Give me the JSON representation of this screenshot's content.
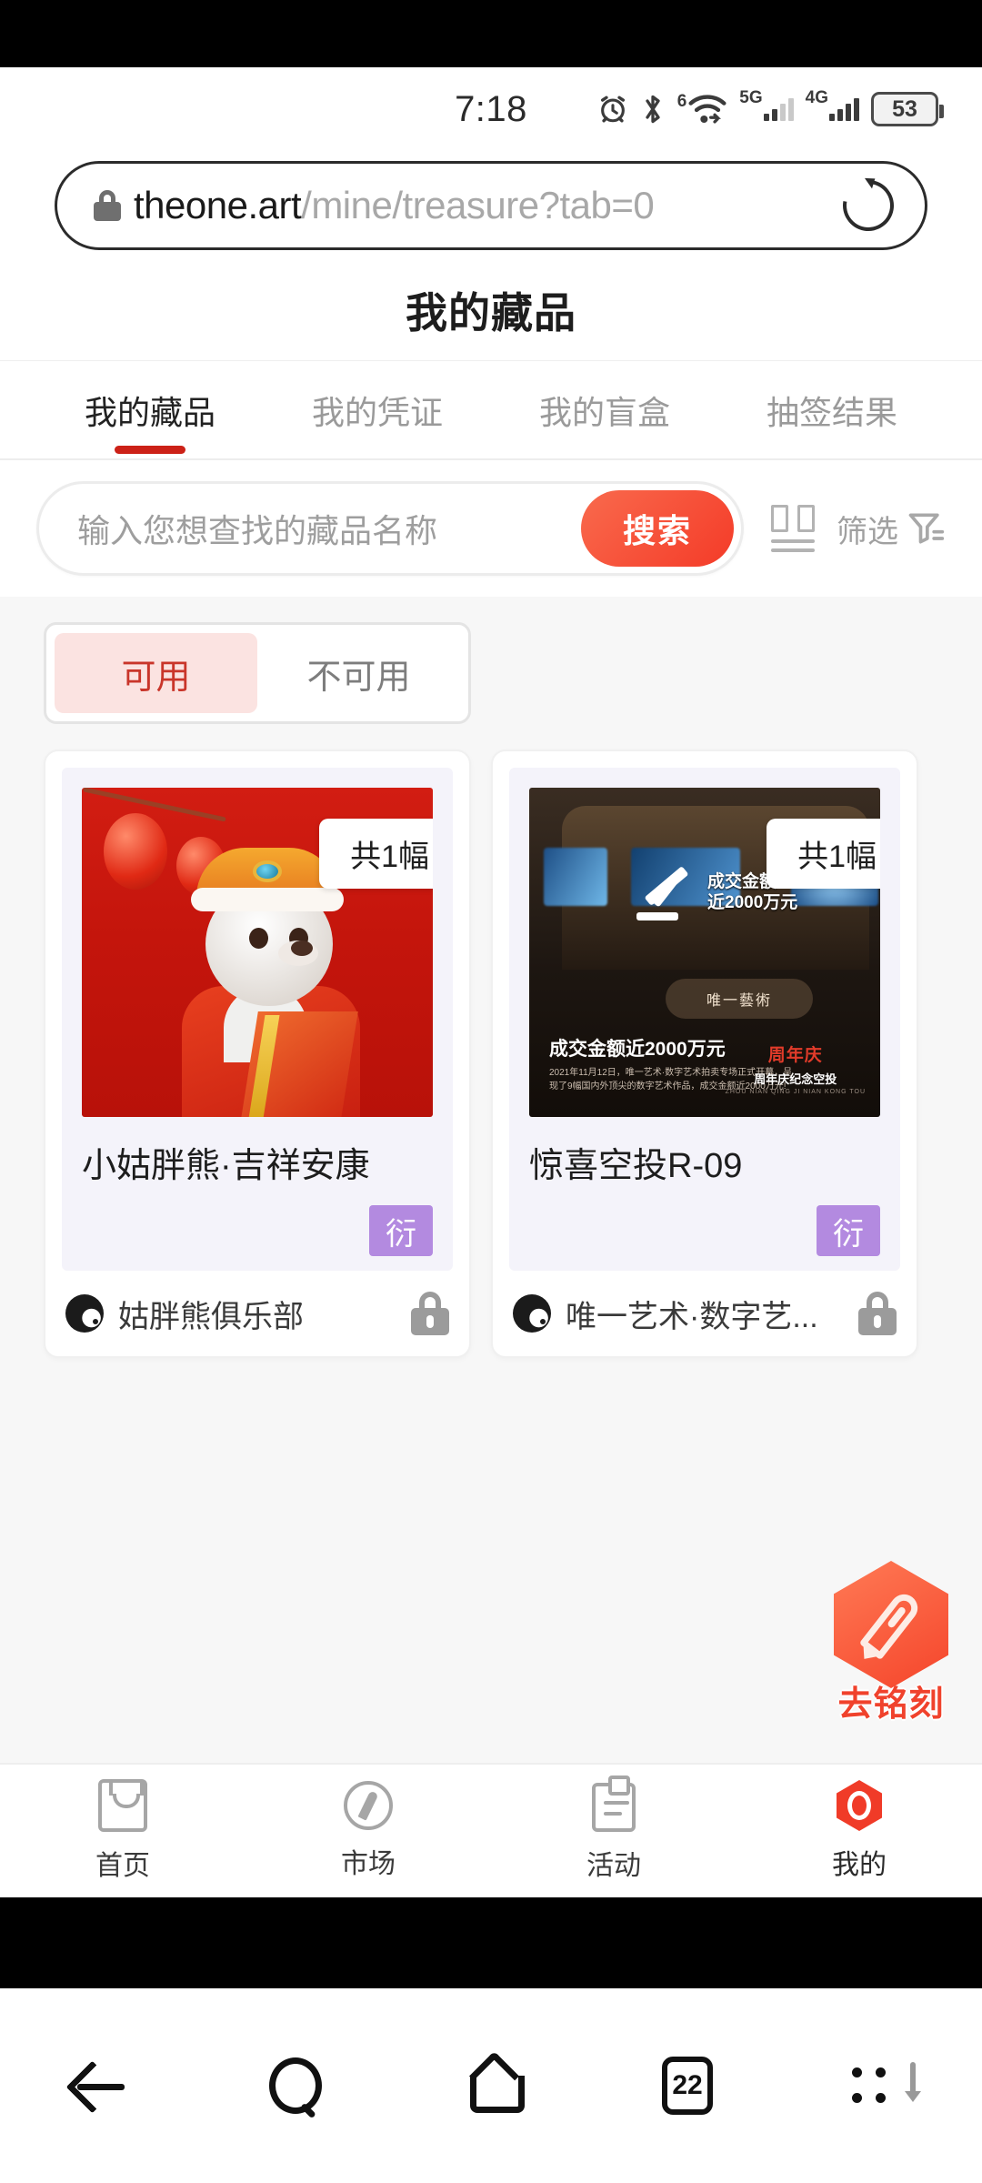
{
  "status_bar": {
    "time": "7:18",
    "battery_percent": "53",
    "icons": [
      "alarm-icon",
      "bluetooth-icon",
      "wifi-6-icon",
      "signal-5g-icon",
      "signal-4g-icon",
      "battery-icon"
    ],
    "wifi_gen": "6",
    "net_5g": "5G",
    "net_4g": "4G"
  },
  "browser": {
    "url_host": "theone.art",
    "url_path": "/mine/treasure?tab=0",
    "lock_icon": "lock-icon",
    "reload_icon": "reload-icon"
  },
  "page": {
    "title": "我的藏品",
    "tabs": [
      {
        "label": "我的藏品",
        "active": true
      },
      {
        "label": "我的凭证",
        "active": false
      },
      {
        "label": "我的盲盒",
        "active": false
      },
      {
        "label": "抽签结果",
        "active": false
      }
    ],
    "search": {
      "placeholder": "输入您想查找的藏品名称",
      "button_label": "搜索",
      "layout_icon": "grid-layout-icon",
      "filter_label": "筛选",
      "filter_icon": "funnel-icon"
    },
    "segment": [
      {
        "label": "可用",
        "active": true
      },
      {
        "label": "不可用",
        "active": false
      }
    ],
    "cards": [
      {
        "count_badge": "共1幅",
        "name": "小姑胖熊·吉祥安康",
        "tag": "衍",
        "publisher": "姑胖熊俱乐部",
        "lock_icon": "lock-icon"
      },
      {
        "count_badge": "共1幅",
        "name": "惊喜空投R-09",
        "tag": "衍",
        "publisher": "唯一艺术·数字艺...",
        "lock_icon": "lock-icon",
        "poster": {
          "headline": "成交金额",
          "headline2": "近2000万元",
          "plate": "唯一藝術",
          "caption_big": "成交金额近2000万元",
          "caption_small": "2021年11月12日，唯一艺术·数字艺术拍卖专场正式开幕，呈现了9幅国内外顶尖的数字艺术作品，成交金额近2000万元!",
          "logo_red": "周年庆",
          "logo_white": "周年庆纪念空投",
          "logo_tiny": "ZHOU NIAN QING JI NIAN KONG TOU"
        }
      }
    ],
    "fab": {
      "label": "去铭刻",
      "icon": "pen-engrave-icon"
    },
    "bottom_nav": [
      {
        "label": "首页",
        "icon": "bag-icon",
        "active": false
      },
      {
        "label": "市场",
        "icon": "compass-icon",
        "active": false
      },
      {
        "label": "活动",
        "icon": "clipboard-icon",
        "active": false
      },
      {
        "label": "我的",
        "icon": "hexagon-profile-icon",
        "active": true
      }
    ]
  },
  "system_nav": {
    "back_icon": "back-arrow-icon",
    "search_icon": "search-icon",
    "home_icon": "home-icon",
    "tabs_count": "22",
    "menu_icon": "more-menu-icon"
  },
  "colors": {
    "accent_red": "#f03b28",
    "tab_underline": "#cc2117",
    "segment_active_bg": "#fbe3e1",
    "segment_active_text": "#c9352a",
    "tag_purple": "#b38ae0",
    "page_bg": "#f7f7f7"
  }
}
